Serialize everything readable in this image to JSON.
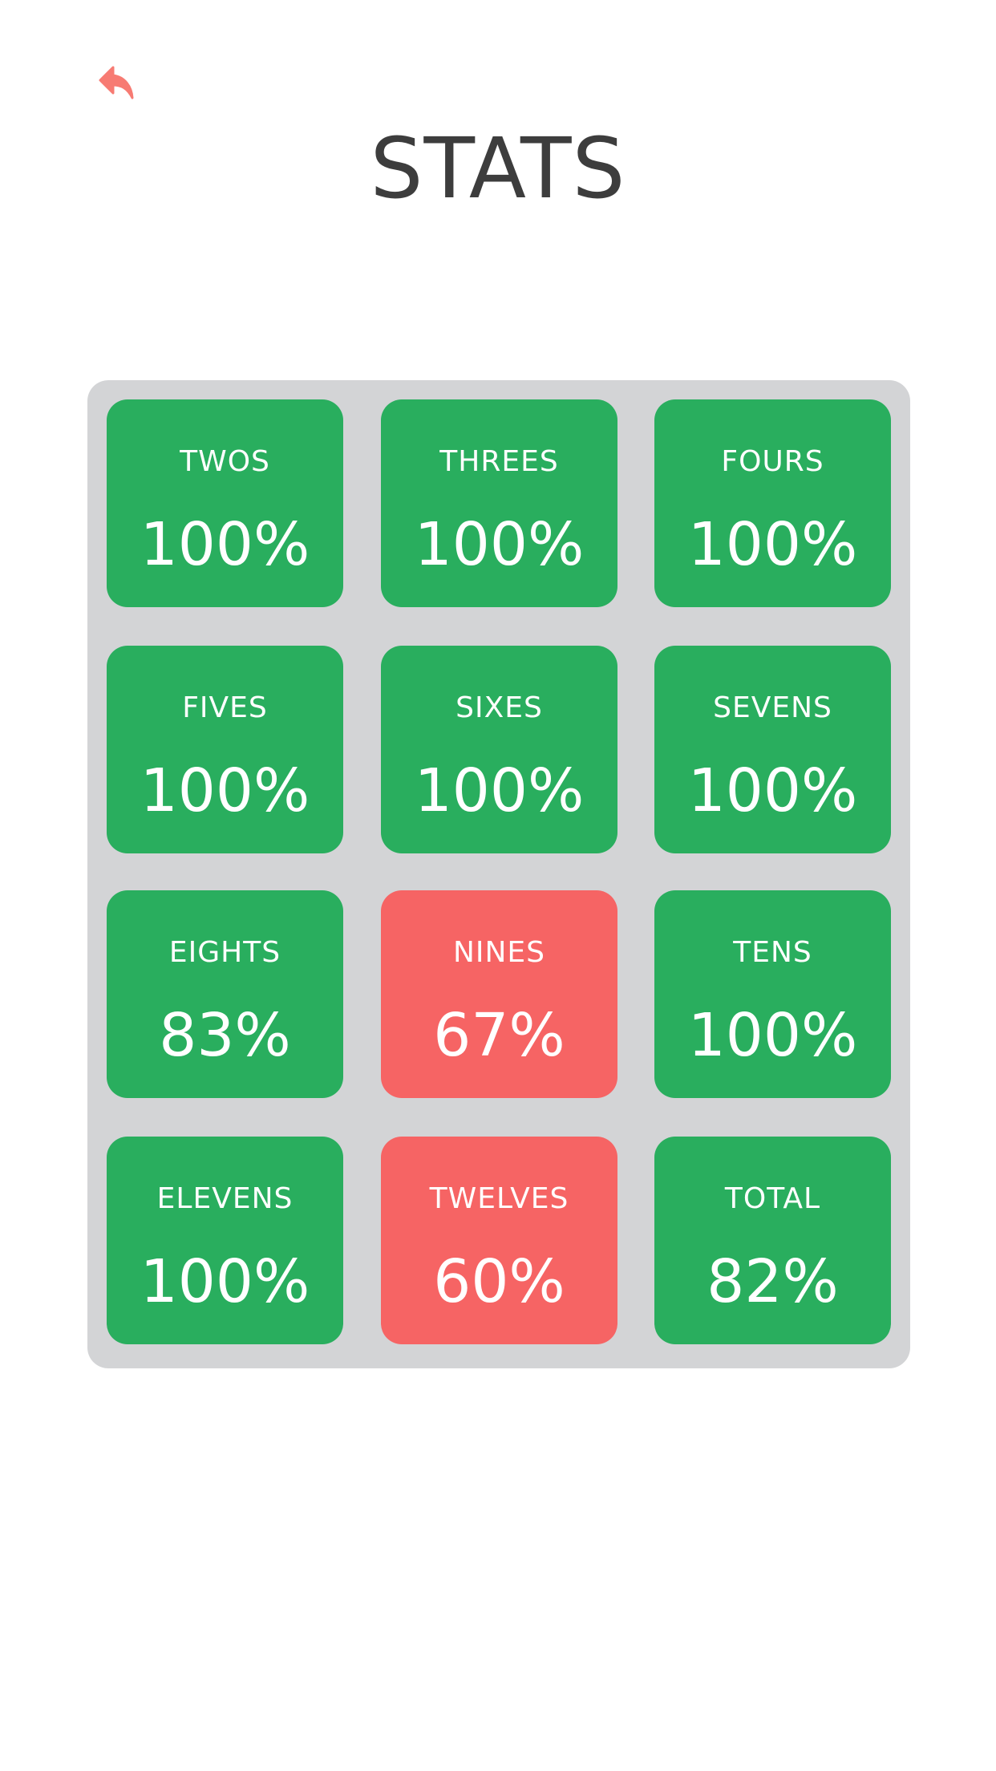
{
  "header": {
    "back_icon": "back-arrow-icon",
    "title": "STATS"
  },
  "colors": {
    "pass": "#29ae5e",
    "fail": "#f66464",
    "panel": "#d3d4d6",
    "title": "#3d3d3d",
    "back_icon": "#f77b73"
  },
  "stats": [
    {
      "label": "TWOS",
      "value": "100%",
      "percent": 100,
      "status": "pass"
    },
    {
      "label": "THREES",
      "value": "100%",
      "percent": 100,
      "status": "pass"
    },
    {
      "label": "FOURS",
      "value": "100%",
      "percent": 100,
      "status": "pass"
    },
    {
      "label": "FIVES",
      "value": "100%",
      "percent": 100,
      "status": "pass"
    },
    {
      "label": "SIXES",
      "value": "100%",
      "percent": 100,
      "status": "pass"
    },
    {
      "label": "SEVENS",
      "value": "100%",
      "percent": 100,
      "status": "pass"
    },
    {
      "label": "EIGHTS",
      "value": "83%",
      "percent": 83,
      "status": "pass"
    },
    {
      "label": "NINES",
      "value": "67%",
      "percent": 67,
      "status": "fail"
    },
    {
      "label": "TENS",
      "value": "100%",
      "percent": 100,
      "status": "pass"
    },
    {
      "label": "ELEVENS",
      "value": "100%",
      "percent": 100,
      "status": "pass"
    },
    {
      "label": "TWELVES",
      "value": "60%",
      "percent": 60,
      "status": "fail"
    },
    {
      "label": "TOTAL",
      "value": "82%",
      "percent": 82,
      "status": "pass"
    }
  ]
}
